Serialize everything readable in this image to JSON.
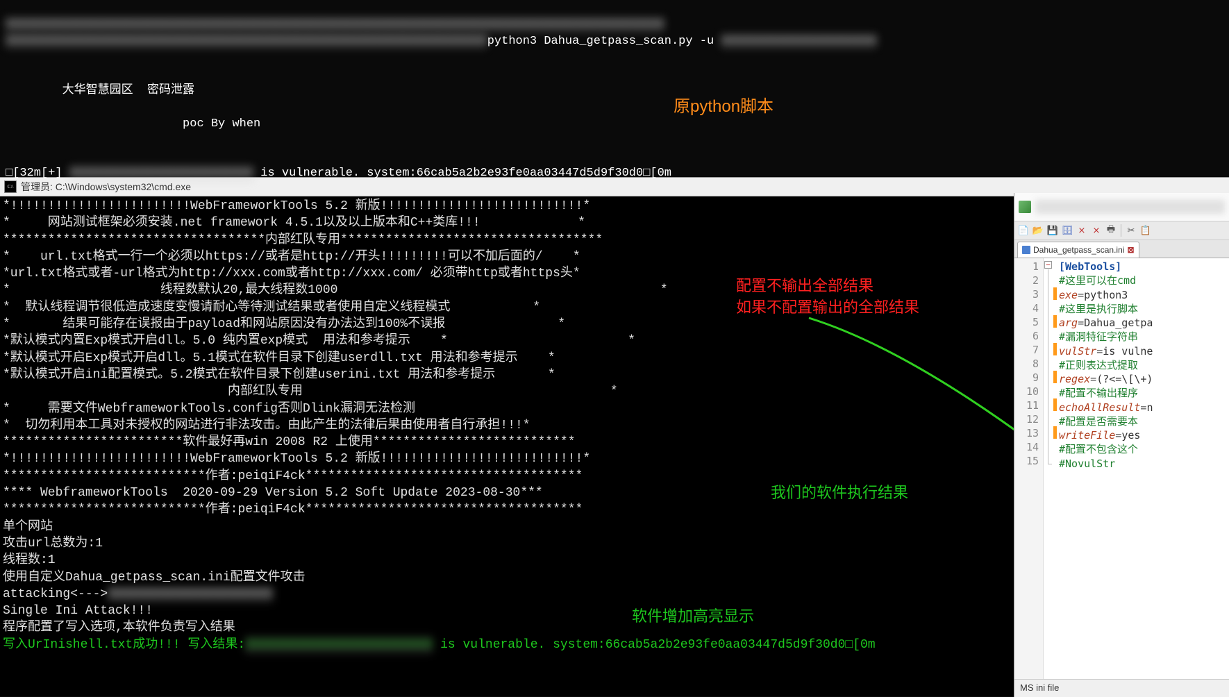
{
  "top": {
    "py_cmd_fragment": "python3 Dahua_getpass_scan.py -u",
    "banner_line1": "        大华智慧园区  密码泄露",
    "banner_line2": "                         poc By when",
    "vuln_prefix": "□[32m[+]",
    "vuln_suffix": " is vulnerable. system:66cab5a2b2e93fe0aa03447d5d9f30d0□[0m"
  },
  "annotations": {
    "orig_py": "原python脚本",
    "config_red_l1": "配置不输出全部结果",
    "config_red_l2": "如果不配置输出的全部结果",
    "our_result": "我们的软件执行结果",
    "highlight": "软件增加高亮显示"
  },
  "cmd": {
    "title": "管理员: C:\\Windows\\system32\\cmd.exe",
    "lines": [
      "*!!!!!!!!!!!!!!!!!!!!!!!!WebFrameworkTools 5.2 新版!!!!!!!!!!!!!!!!!!!!!!!!!!!*",
      "*     网站测试框架必须安装.net framework 4.5.1以及以上版本和C++类库!!!             *",
      "***********************************内部红队专用***********************************",
      "*    url.txt格式一行一个必须以https://或者是http://开头!!!!!!!!!可以不加后面的/    *",
      "*url.txt格式或者-url格式为http://xxx.com或者http://xxx.com/ 必须带http或者https头*",
      "*                    线程数默认20,最大线程数1000                                           *",
      "*  默认线程调节很低造成速度变慢请耐心等待测试结果或者使用自定义线程模式           *",
      "*       结果可能存在误报由于payload和网站原因没有办法达到100%不误报               *",
      "*默认模式内置Exp模式开启dll。5.0 纯内置exp模式  用法和参考提示    *                        *",
      "*默认模式开启Exp模式开启dll。5.1模式在软件目录下创建userdll.txt 用法和参考提示    *",
      "*默认模式开启ini配置模式。5.2模式在软件目录下创建userini.txt 用法和参考提示       *",
      "                              内部红队专用                                         *",
      "*     需要文件WebframeworkTools.config否则Dlink漏洞无法检测                         ",
      "*  切勿利用本工具对未授权的网站进行非法攻击。由此产生的法律后果由使用者自行承担!!!*",
      "************************软件最好再win 2008 R2 上使用***************************       ",
      "*!!!!!!!!!!!!!!!!!!!!!!!!WebFrameworkTools 5.2 新版!!!!!!!!!!!!!!!!!!!!!!!!!!!*",
      "***************************作者:peiqiF4ck*************************************",
      "**** WebframeworkTools  2020-09-29 Version 5.2 Soft Update 2023-08-30***",
      "***************************作者:peiqiF4ck*************************************",
      "单个网站",
      "攻击url总数为:1",
      "线程数:1",
      "使用自定义Dahua_getpass_scan.ini配置文件攻击",
      "attacking<--->",
      "Single Ini Attack!!!",
      "程序配置了写入选项,本软件负责写入结果"
    ],
    "result_line_prefix": "写入UrInishell.txt成功!!! 写入结果:",
    "result_line_suffix": " is vulnerable. system:66cab5a2b2e93fe0aa03447d5d9f30d0□[0m"
  },
  "editor": {
    "tab_filename": "Dahua_getpass_scan.ini",
    "status": "MS ini file",
    "lines": [
      {
        "n": 1,
        "type": "section",
        "text": "[WebTools]"
      },
      {
        "n": 2,
        "type": "comment",
        "text": "#这里可以在cmd"
      },
      {
        "n": 3,
        "type": "kv",
        "key": "exe",
        "val": "python3",
        "mod": true
      },
      {
        "n": 4,
        "type": "comment",
        "text": "#这里是执行脚本"
      },
      {
        "n": 5,
        "type": "kv",
        "key": "arg",
        "val": "Dahua_getpa",
        "mod": true
      },
      {
        "n": 6,
        "type": "comment",
        "text": "#漏洞特征字符串"
      },
      {
        "n": 7,
        "type": "kv",
        "key": "vulStr",
        "val": "is vulne",
        "mod": true
      },
      {
        "n": 8,
        "type": "comment",
        "text": "#正则表达式提取"
      },
      {
        "n": 9,
        "type": "kv",
        "key": "regex",
        "val": "(?<=\\[\\+)",
        "mod": true
      },
      {
        "n": 10,
        "type": "comment",
        "text": "#配置不输出程序"
      },
      {
        "n": 11,
        "type": "kv",
        "key": "echoAllResult",
        "val": "n",
        "mod": true
      },
      {
        "n": 12,
        "type": "comment",
        "text": "#配置是否需要本"
      },
      {
        "n": 13,
        "type": "kv",
        "key": "writeFile",
        "val": "yes",
        "mod": true
      },
      {
        "n": 14,
        "type": "comment",
        "text": "#配置不包含这个"
      },
      {
        "n": 15,
        "type": "comment",
        "text": "#NovulStr"
      }
    ]
  }
}
